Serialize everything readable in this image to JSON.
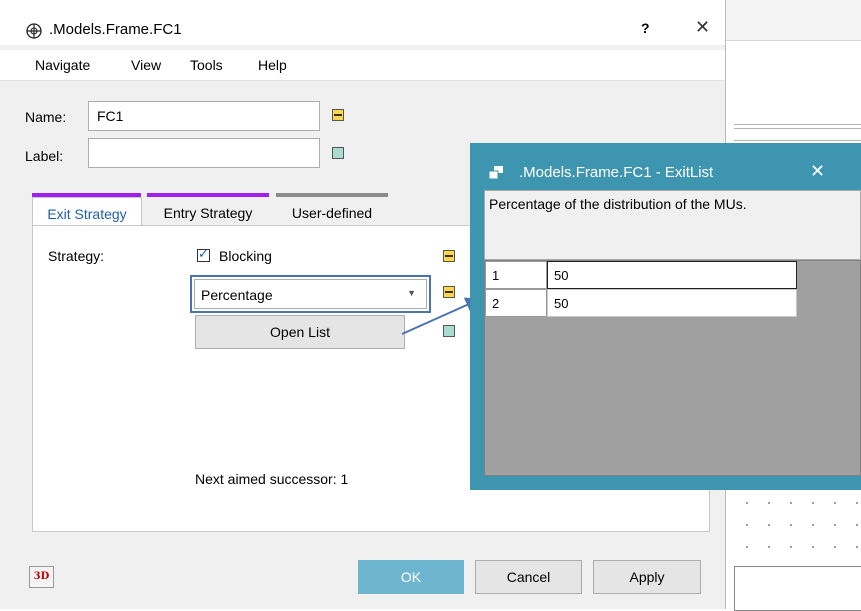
{
  "main_window": {
    "title": ".Models.Frame.FC1",
    "help_label": "?",
    "close_glyph": "✕"
  },
  "menu": {
    "items": [
      "Navigate",
      "View",
      "Tools",
      "Help"
    ]
  },
  "fields": {
    "name_label": "Name:",
    "name_value": "FC1",
    "label_label": "Label:",
    "label_value": ""
  },
  "tabs": [
    {
      "label": "Exit Strategy",
      "strip_color": "#a020f0",
      "active": true
    },
    {
      "label": "Entry Strategy",
      "strip_color": "#a020f0",
      "active": false
    },
    {
      "label": "User-defined",
      "strip_color": "#8c8c8c",
      "active": false
    }
  ],
  "exit_strategy": {
    "strategy_label": "Strategy:",
    "blocking_label": "Blocking",
    "blocking_checked": true,
    "strategy_select_value": "Percentage",
    "open_list_label": "Open List",
    "next_successor_text": "Next aimed successor: 1"
  },
  "buttons": {
    "three_d": "3D",
    "ok": "OK",
    "cancel": "Cancel",
    "apply": "Apply"
  },
  "exitlist_window": {
    "title": ".Models.Frame.FC1 - ExitList",
    "close_glyph": "✕",
    "description": "Percentage of the distribution of the MUs.",
    "rows": [
      {
        "index": "1",
        "value": "50"
      },
      {
        "index": "2",
        "value": "50"
      }
    ]
  },
  "colors": {
    "ok_button": "#6eb6cf",
    "exitlist_frame": "#3d95b0",
    "highlight_border": "#4a73b5",
    "active_tab_text": "#1f5fa8"
  }
}
